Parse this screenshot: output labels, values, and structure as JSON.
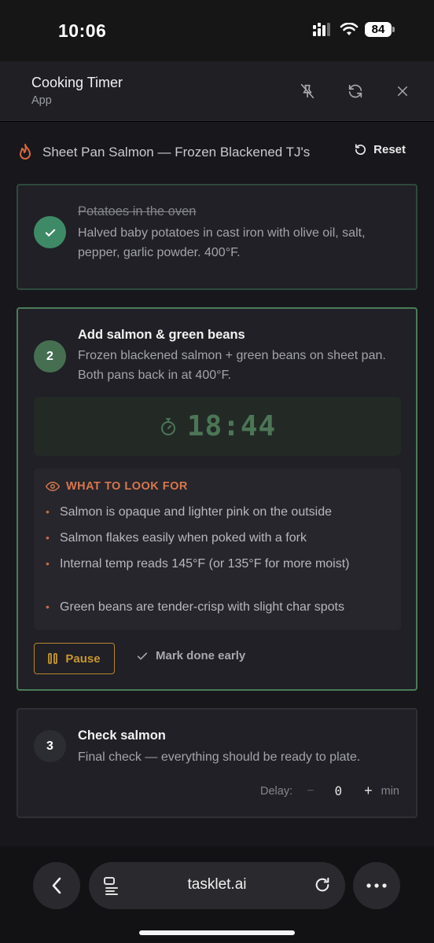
{
  "status_bar": {
    "time": "10:06",
    "battery": "84"
  },
  "header": {
    "title": "Cooking Timer",
    "subtitle": "App"
  },
  "recipe": {
    "title": "Sheet Pan Salmon — Frozen Blackened TJ's",
    "reset_label": "Reset"
  },
  "steps": [
    {
      "title": "Potatoes in the oven",
      "description": "Halved baby potatoes in cast iron with olive oil, salt, pepper, garlic powder. 400°F.",
      "state": "done"
    },
    {
      "number": "2",
      "title": "Add salmon & green beans",
      "description": "Frozen blackened salmon + green beans on sheet pan. Both pans back in at 400°F.",
      "state": "active",
      "timer": "18:44",
      "look_for": {
        "header": "WHAT TO LOOK FOR",
        "items": [
          "Salmon is opaque and lighter pink on the outside",
          "Salmon flakes easily when poked with a fork",
          "Internal temp reads 145°F (or 135°F for more moist)",
          "Green beans are tender-crisp with slight char spots"
        ]
      },
      "pause_label": "Pause",
      "done_early_label": "Mark done early"
    },
    {
      "number": "3",
      "title": "Check salmon",
      "description": "Final check — everything should be ready to plate.",
      "state": "pending",
      "delay": {
        "label": "Delay:",
        "minus": "−",
        "value": "0",
        "plus": "+",
        "unit": "min"
      }
    }
  ],
  "browser": {
    "url": "tasklet.ai"
  },
  "colors": {
    "accent_green": "#4a7c5a",
    "accent_orange": "#d8764c",
    "pause_amber": "#c8962f"
  }
}
